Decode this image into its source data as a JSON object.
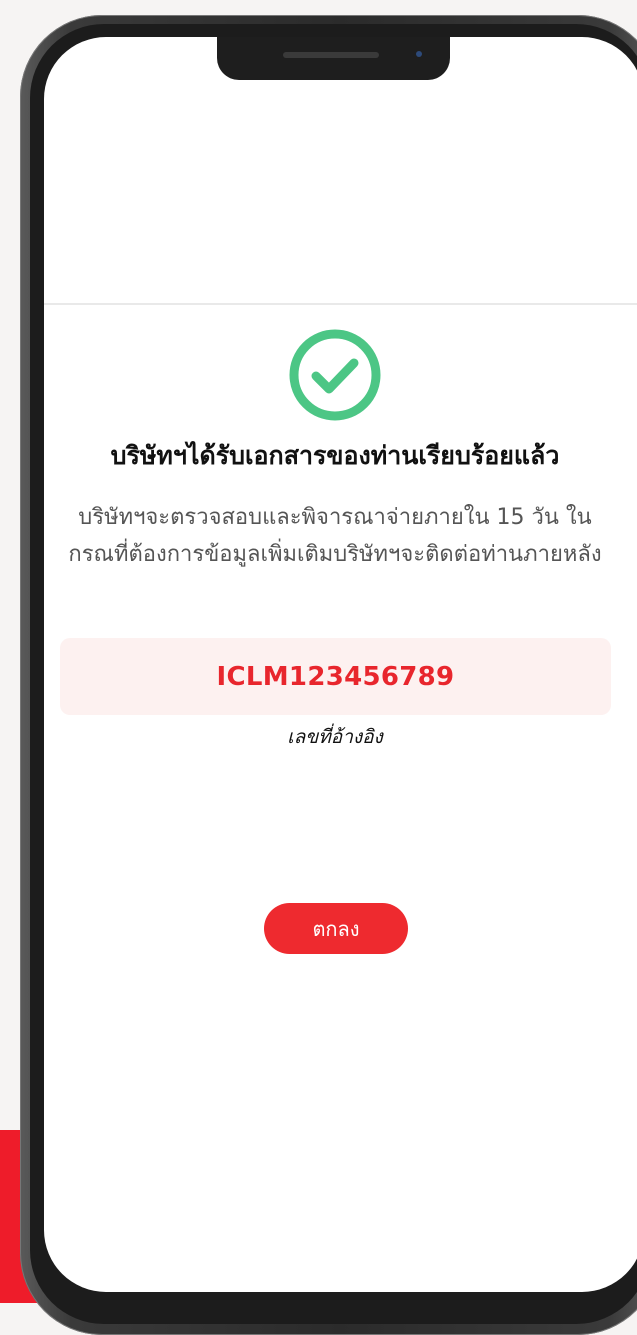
{
  "dialog": {
    "title": "บริษัทฯได้รับเอกสารของท่านเรียบร้อยแล้ว",
    "description": "บริษัทฯจะตรวจสอบและพิจารณาจ่ายภายใน 15 วัน ในกรณที่ต้องการข้อมูลเพิ่มเติมบริษัทฯจะติดต่อท่านภายหลัง",
    "reference_number": "ICLM123456789",
    "reference_label": "เลขที่อ้างอิง",
    "ok_label": "ตกลง",
    "success_icon": "check-circle-icon"
  },
  "colors": {
    "accent": "#ee2a2f",
    "success": "#4cc685",
    "reference_text": "#e8262d",
    "reference_background": "#fdf1f0",
    "brand_band": "#ee1c2a"
  }
}
